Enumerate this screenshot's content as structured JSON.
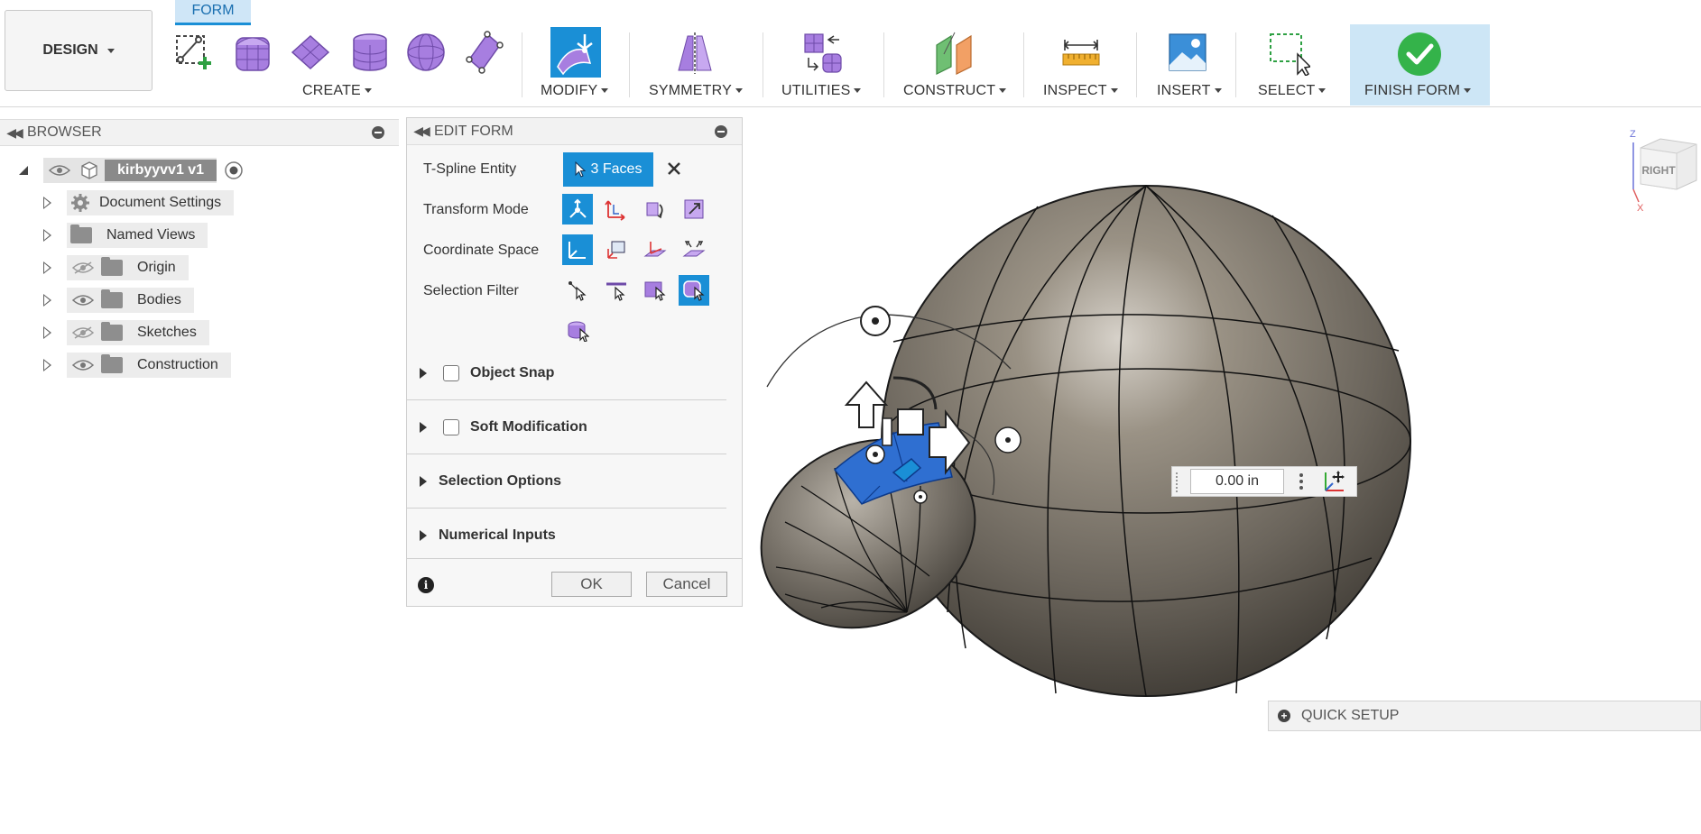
{
  "toolbar": {
    "workspace": "DESIGN",
    "active_tab": "FORM",
    "groups": {
      "create": "CREATE",
      "modify": "MODIFY",
      "symmetry": "SYMMETRY",
      "utilities": "UTILITIES",
      "construct": "CONSTRUCT",
      "inspect": "INSPECT",
      "insert": "INSERT",
      "select": "SELECT",
      "finish": "FINISH FORM"
    },
    "colors": {
      "accent": "#1a8fd6",
      "tab_bg": "#cfe6f7",
      "finish_bg": "#cde6f6",
      "icon_purple": "#a77ee0"
    }
  },
  "browser": {
    "title": "BROWSER",
    "root": "kirbyyvv1 v1",
    "items": [
      {
        "label": "Document Settings",
        "icon": "gear-icon"
      },
      {
        "label": "Named Views",
        "icon": "folder-icon"
      },
      {
        "label": "Origin",
        "icon": "folder-icon",
        "visibility": "hidden"
      },
      {
        "label": "Bodies",
        "icon": "folder-icon",
        "visibility": "visible"
      },
      {
        "label": "Sketches",
        "icon": "folder-icon",
        "visibility": "hidden"
      },
      {
        "label": "Construction",
        "icon": "folder-icon",
        "visibility": "visible"
      }
    ]
  },
  "edit_form": {
    "title": "EDIT FORM",
    "tspline_label": "T-Spline Entity",
    "selection": "3 Faces",
    "transform_label": "Transform Mode",
    "coord_label": "Coordinate Space",
    "filter_label": "Selection Filter",
    "sections": {
      "object_snap": "Object Snap",
      "soft_mod": "Soft Modification",
      "sel_options": "Selection Options",
      "numerical": "Numerical Inputs"
    },
    "ok": "OK",
    "cancel": "Cancel"
  },
  "viewport": {
    "distance_value": "0.00 in",
    "quick_setup": "QUICK SETUP",
    "viewcube_face": "RIGHT",
    "axis_z": "Z",
    "axis_x": "X"
  }
}
